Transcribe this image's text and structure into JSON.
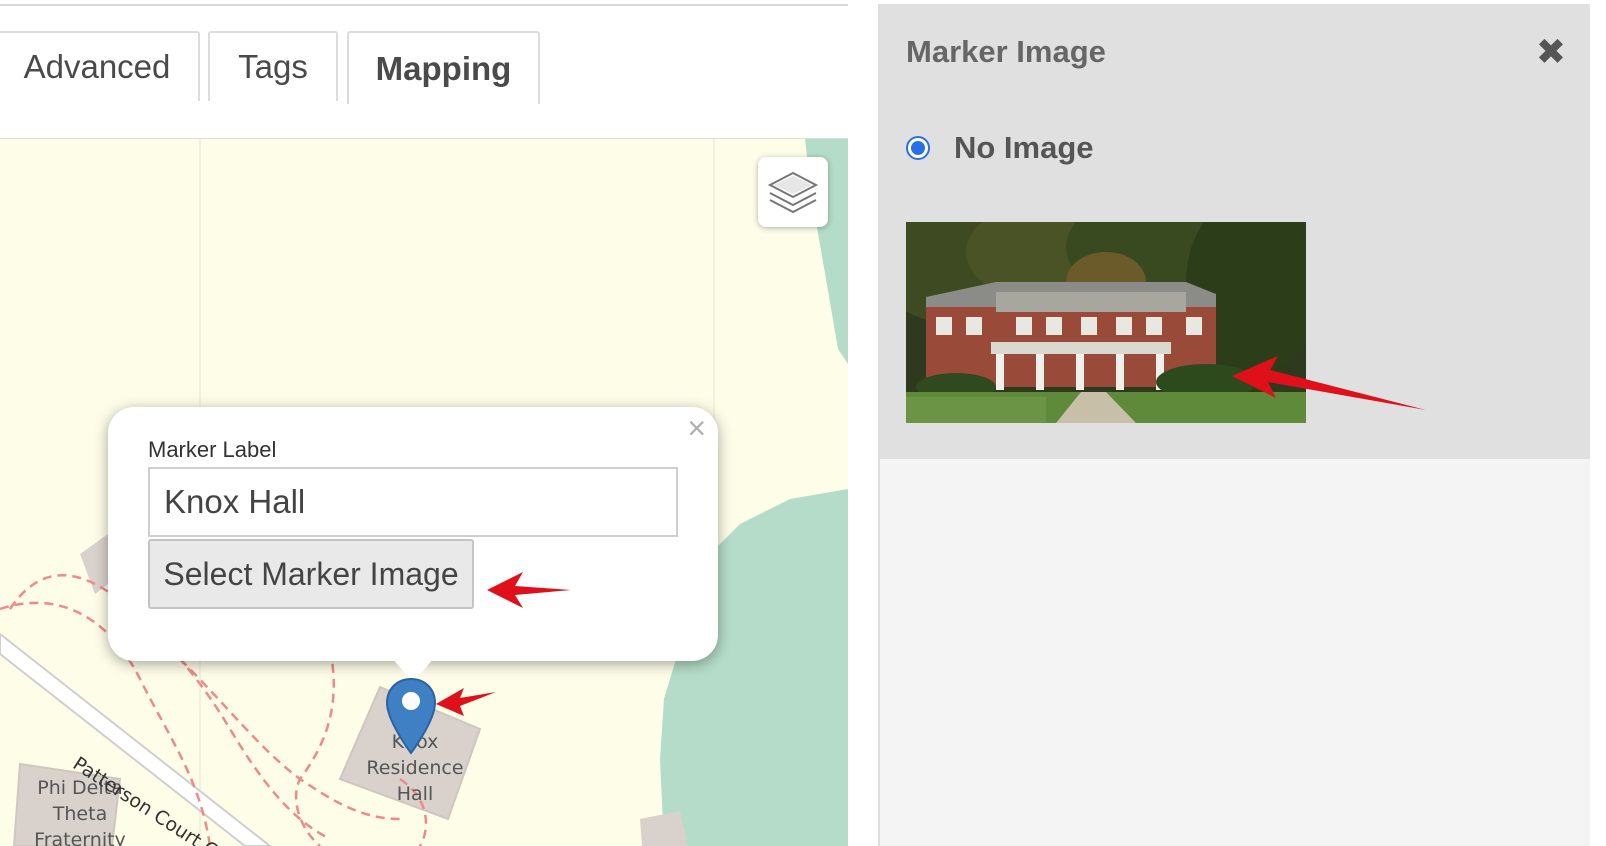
{
  "tabs": [
    {
      "label": "Advanced"
    },
    {
      "label": "Tags"
    },
    {
      "label": "Mapping"
    }
  ],
  "active_tab": "Mapping",
  "popup": {
    "field_label": "Marker Label",
    "input_value": "Knox Hall",
    "button_label": "Select Marker Image",
    "close_glyph": "×"
  },
  "map_labels": {
    "building": [
      "Knox",
      "Residence",
      "Hall"
    ],
    "fraternity": [
      "Phi Delta",
      "Theta",
      "Fraternity"
    ],
    "street": "Patterson Court Circle"
  },
  "side_panel": {
    "title": "Marker Image",
    "close_glyph": "✖",
    "radio_label": "No Image",
    "radio_selected": true
  },
  "icons": {
    "layers": "layers-icon",
    "marker": "map-pin-icon",
    "annotation": "red-arrow"
  },
  "colors": {
    "marker_blue": "#3f7fc4",
    "radio_blue": "#2b6fe8",
    "arrow_red": "#e0101a",
    "map_water": "#b4dcc8",
    "map_land": "#fdfde8"
  }
}
